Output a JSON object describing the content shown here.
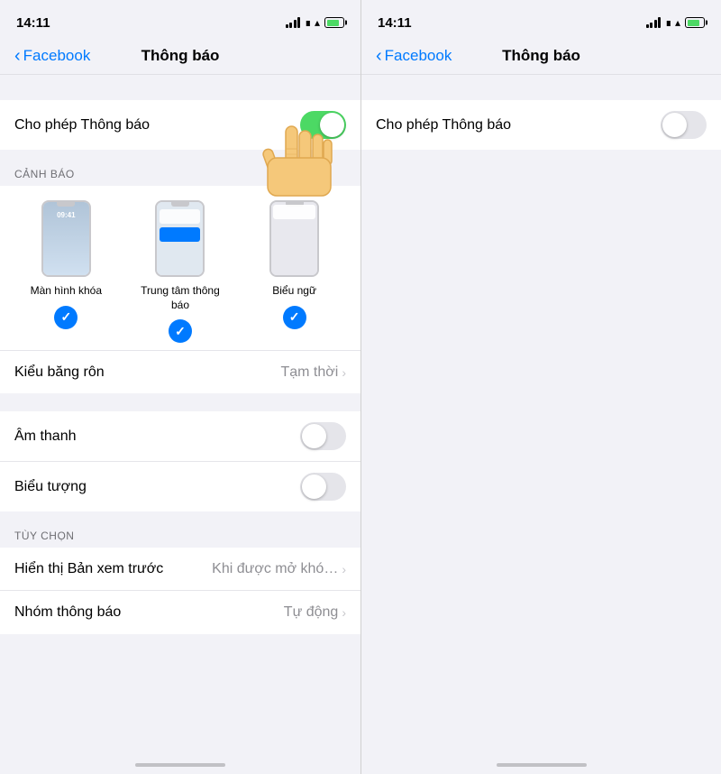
{
  "left_screen": {
    "status": {
      "time": "14:11"
    },
    "nav": {
      "back_label": "Facebook",
      "title": "Thông báo"
    },
    "allow_notif": {
      "label": "Cho phép Thông báo",
      "toggle": "on"
    },
    "alerts_section": {
      "heading": "CẢNH BÁO",
      "items": [
        {
          "id": "lock",
          "label": "Màn hình khóa",
          "checked": true
        },
        {
          "id": "notif-center",
          "label": "Trung tâm thông báo",
          "checked": true
        },
        {
          "id": "banner",
          "label": "Biểu ngữ",
          "checked": true
        }
      ]
    },
    "banner_style": {
      "label": "Kiểu băng rôn",
      "value": "Tạm thời"
    },
    "sounds_section": {
      "items": [
        {
          "label": "Âm thanh",
          "toggle": "off"
        },
        {
          "label": "Biểu tượng",
          "toggle": "off"
        }
      ]
    },
    "options_section": {
      "heading": "TÙY CHỌN",
      "items": [
        {
          "label": "Hiển thị Bản xem trước",
          "value": "Khi được mở khó…"
        },
        {
          "label": "Nhóm thông báo",
          "value": "Tự động"
        }
      ]
    }
  },
  "right_screen": {
    "status": {
      "time": "14:11"
    },
    "nav": {
      "back_label": "Facebook",
      "title": "Thông báo"
    },
    "allow_notif": {
      "label": "Cho phép Thông báo",
      "toggle": "off"
    }
  }
}
